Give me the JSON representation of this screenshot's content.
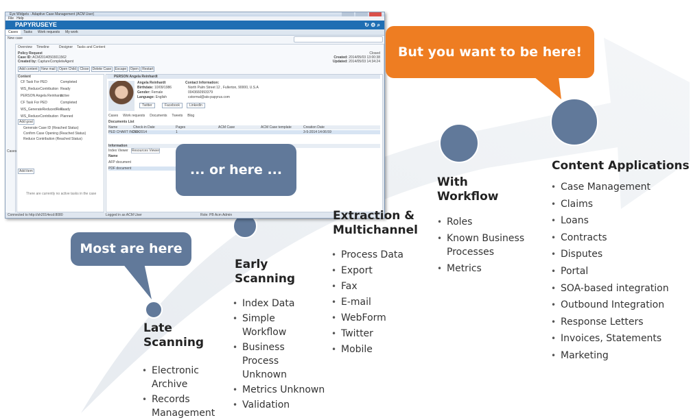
{
  "window": {
    "title": "Eye Widgets - Adaptive Case Management (ACM User)",
    "menu": [
      "File",
      "Help"
    ],
    "brand": "PAPYRUSEYE",
    "nav_tabs": [
      "Cases",
      "Tasks",
      "Work requests",
      "My work"
    ],
    "new_case": "New case",
    "case_tabs": [
      "Overview",
      "Timeline",
      "Designer",
      "Tasks and Content"
    ],
    "case_title": "Policy Request",
    "case_id_label": "Case ID:",
    "case_id": "ACM20140503011562",
    "created_by_label": "Created by:",
    "created_by": "CaptureCompleteAgent",
    "status": "Closed",
    "created_label": "Created:",
    "created": "2014/05/03 13:00:38",
    "updated_label": "Updated:",
    "updated": "2014/05/03 14:34:24",
    "toolbar": [
      "Add content",
      "New mail",
      "Open Child",
      "Close",
      "Delete Case",
      "Escape",
      "Open",
      "Restart"
    ],
    "content_header": "Content",
    "content_rows": [
      {
        "name": "CF Task For PED",
        "state": "Completed"
      },
      {
        "name": "WS_ReduceContribution",
        "state": "Ready"
      },
      {
        "name": "PERSON Angela Reinhardt",
        "state": "active"
      },
      {
        "name": "CF Task For PED",
        "state": "Completed"
      },
      {
        "name": "WS_GenerateReducedRec...",
        "state": "Ready"
      },
      {
        "name": "WS_ReduceContribution",
        "state": "Planned"
      }
    ],
    "add_goal": "Add goal",
    "goals": [
      "Generate Case ID (Reached Status)",
      "Confirm Case Opening (Reached Status)",
      "Reduce Contribution (Reached Status)"
    ],
    "add_item": "Add item",
    "no_tasks": "There are currently no active tasks in the case",
    "side_label": "Cases",
    "person_header": "PERSON Angela Reinhardt",
    "person_name": "Angela Reinhardt",
    "birthdate_label": "Birthdate:",
    "birthdate": "10/09/1986",
    "gender_label": "Gender:",
    "gender": "Female",
    "language_label": "Language:",
    "language": "English",
    "contact_label": "Contact Information:",
    "address": "North Palm Street 12 , Fullerton, 90000, U.S.A",
    "phone": "0043660993379",
    "email": "cstormal@ats-papyrus.com",
    "social": [
      "Twitter",
      "Facebook",
      "LinkedIn"
    ],
    "detail_tabs": [
      "Cases",
      "Work requests",
      "Documents",
      "Tweets",
      "Blog"
    ],
    "documents_list": "Documents List",
    "doc_columns": [
      "Name",
      "Check-in Date",
      "Pages",
      "ACM Case",
      "ACM Case template",
      "Creation Date"
    ],
    "doc_row": {
      "name": "PED CHART INDEX",
      "date": "3-5-2014",
      "pages": "1",
      "created": "3-5-2014 14:06:59"
    },
    "info_header": "Information",
    "info_tabs": [
      "Index Viewer",
      "Resources Viewer"
    ],
    "info_name": "Name",
    "info_rows": [
      "AFP document",
      "PDF document"
    ],
    "status_left": "Connected to http://sh2014ecd:8080",
    "status_mid": "Logged in as ACM User",
    "status_right": "Role: PB Acm Admin"
  },
  "bubbles": {
    "most": "Most are here",
    "or_here": "... or here ...",
    "want": "But you want to be here!"
  },
  "stages": {
    "late": {
      "title_1": "Late",
      "title_2": "Scanning",
      "items": [
        "Electronic Archive",
        "Records Management"
      ]
    },
    "early": {
      "title_1": "Early",
      "title_2": "Scanning",
      "items": [
        "Index Data",
        "Simple Workflow",
        "Business Process Unknown",
        "Metrics Unknown",
        "Validation"
      ]
    },
    "extraction": {
      "title_1": "Extraction &",
      "title_2": "Multichannel",
      "items": [
        "Process Data",
        "Export",
        "Fax",
        "E-mail",
        "WebForm",
        "Twitter",
        "Mobile"
      ]
    },
    "workflow": {
      "title_1": "With",
      "title_2": "Workflow",
      "items": [
        "Roles",
        "Known Business Processes",
        "Metrics"
      ]
    },
    "content": {
      "title_1": "Content Applications",
      "items": [
        "Case Management",
        "Claims",
        "Loans",
        "Contracts",
        "Disputes",
        "Portal",
        "SOA-based integration",
        "Outbound Integration",
        "Response Letters",
        "Invoices, Statements",
        "Marketing"
      ]
    }
  },
  "colors": {
    "arrow": "#eef1f4",
    "dot": "#61799a",
    "bubble_blue": "#61799a",
    "bubble_orange": "#ee7d22"
  }
}
